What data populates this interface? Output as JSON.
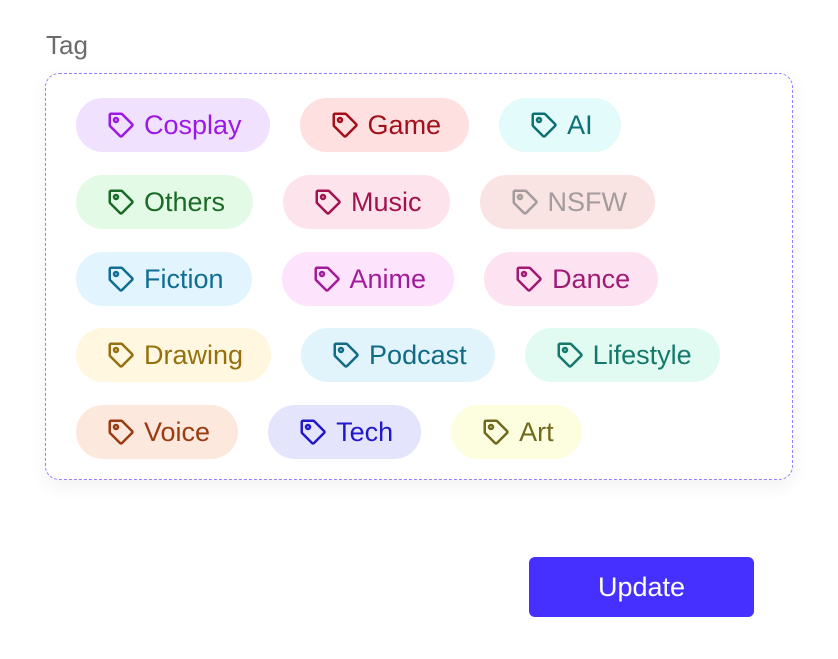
{
  "form": {
    "tag_label": "Tag",
    "update_label": "Update"
  },
  "tags": {
    "row1": [
      {
        "label": "Cosplay",
        "fg": "#9b19e6",
        "bg": "#f0e2ff",
        "icon": "tag-icon"
      },
      {
        "label": "Game",
        "fg": "#a30f1a",
        "bg": "#ffe0e0",
        "icon": "tag-icon"
      },
      {
        "label": "AI",
        "fg": "#0e6f74",
        "bg": "#e3fbfb",
        "icon": "tag-icon"
      }
    ],
    "row2": [
      {
        "label": "Others",
        "fg": "#1b6a26",
        "bg": "#e3fbe6",
        "icon": "tag-icon"
      },
      {
        "label": "Music",
        "fg": "#a0134f",
        "bg": "#fde3ec",
        "icon": "tag-icon"
      },
      {
        "label": "NSFW",
        "fg": "#a39c9c",
        "bg": "#f9e3e3",
        "icon": "tag-icon"
      }
    ],
    "row3": [
      {
        "label": "Fiction",
        "fg": "#116d93",
        "bg": "#e2f4fd",
        "icon": "tag-icon"
      },
      {
        "label": "Anime",
        "fg": "#a21b9a",
        "bg": "#fde3fb",
        "icon": "tag-icon"
      },
      {
        "label": "Dance",
        "fg": "#a01a74",
        "bg": "#fde3f1",
        "icon": "tag-icon"
      }
    ],
    "row4": [
      {
        "label": "Drawing",
        "fg": "#94700f",
        "bg": "#fff7df",
        "icon": "tag-icon"
      },
      {
        "label": "Podcast",
        "fg": "#116b85",
        "bg": "#e2f4fb",
        "icon": "tag-icon"
      },
      {
        "label": "Lifestyle",
        "fg": "#14796a",
        "bg": "#e1fbf3",
        "icon": "tag-icon"
      }
    ],
    "row5": [
      {
        "label": "Voice",
        "fg": "#9a3b10",
        "bg": "#fde8dd",
        "icon": "tag-icon"
      },
      {
        "label": "Tech",
        "fg": "#2318c8",
        "bg": "#e5e4fd",
        "icon": "tag-icon"
      },
      {
        "label": "Art",
        "fg": "#6f6a1c",
        "bg": "#fdfde0",
        "icon": "tag-icon"
      }
    ]
  },
  "colors": {
    "button_bg": "#4630ff",
    "box_border": "#9b7bff"
  }
}
